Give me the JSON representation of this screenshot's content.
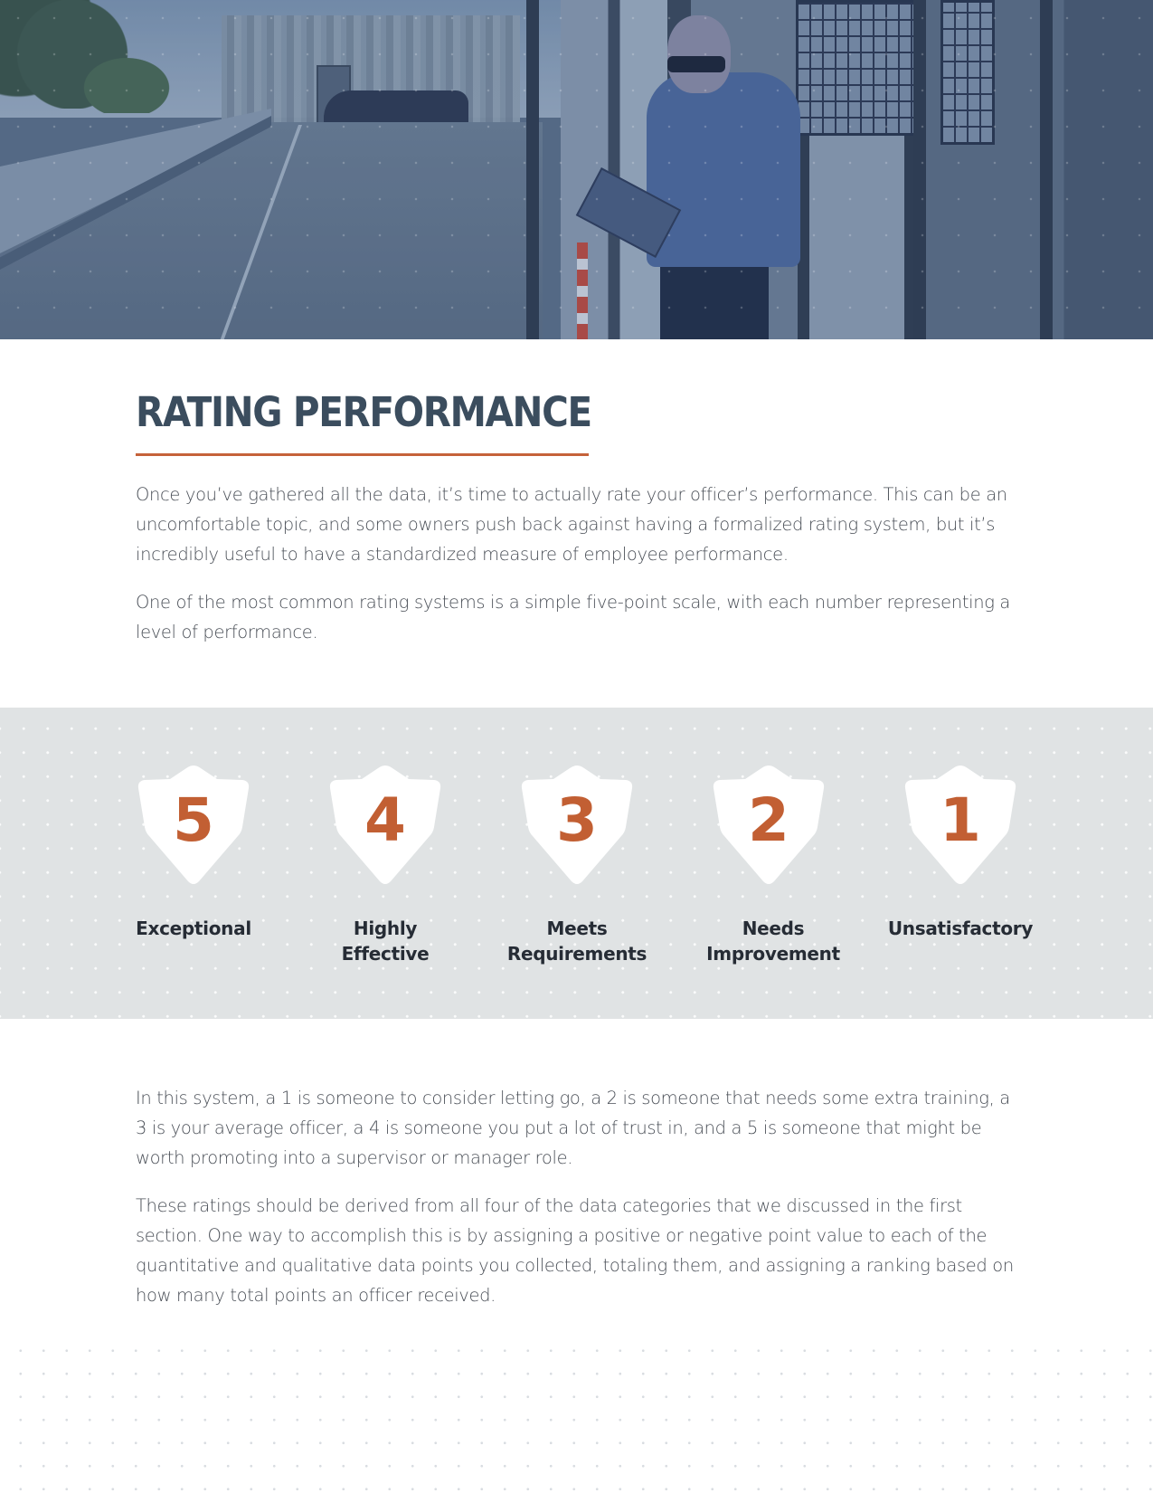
{
  "hero": {
    "image_description": "Security officer in blue uniform reading a tablet at a gatehouse",
    "icon": "hero-photo"
  },
  "heading": {
    "title": "RATING PERFORMANCE"
  },
  "intro": {
    "paragraphs": [
      "Once you’ve gathered all the data, it’s time to actually rate your officer’s performance. This can be an uncomfortable topic, and some owners push back against having a formalized rating system, but it’s incredibly useful to have a standardized measure of employee performance.",
      "One of the most common rating systems is a simple five-point scale, with each number representing a level of performance."
    ]
  },
  "ratings": {
    "items": [
      {
        "value": "5",
        "label": "Exceptional",
        "icon": "shield-icon"
      },
      {
        "value": "4",
        "label": "Highly Effective",
        "icon": "shield-icon"
      },
      {
        "value": "3",
        "label": "Meets Requirements",
        "icon": "shield-icon"
      },
      {
        "value": "2",
        "label": "Needs Improvement",
        "icon": "shield-icon"
      },
      {
        "value": "1",
        "label": "Unsatisfactory",
        "icon": "shield-icon"
      }
    ]
  },
  "body": {
    "paragraphs": [
      "In this system, a 1 is someone to consider letting go, a 2 is someone that needs some extra training, a 3 is your average officer, a 4 is someone you put a lot of trust in, and a 5 is someone that might be worth promoting into a supervisor or manager role.",
      "These ratings should be derived from all four of the data categories that we discussed in the first section. One way to accomplish this is by assigning a positive or negative point value to each of the quantitative and qualitative data points you collected, totaling them, and assigning a ranking based on how many total points an officer received."
    ]
  },
  "colors": {
    "heading": "#3b4d5e",
    "accent": "#c5623a",
    "band_background": "#e0e3e4",
    "body_text": "#4a4f57",
    "label_text": "#262c35"
  }
}
